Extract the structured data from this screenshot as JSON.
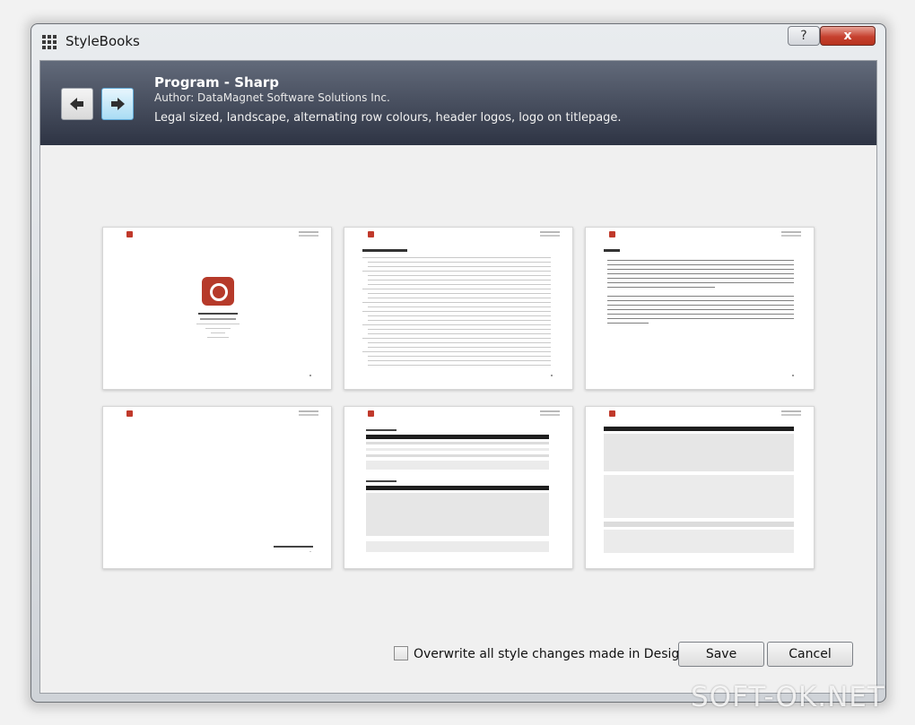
{
  "window": {
    "title": "StyleBooks",
    "help_label": "?",
    "close_label": "x"
  },
  "header": {
    "title": "Program - Sharp",
    "author": "Author: DataMagnet Software Solutions Inc.",
    "description": "Legal sized, landscape, alternating row colours, header logos, logo on titlepage.",
    "prev_icon": "arrow-left-icon",
    "next_icon": "arrow-right-icon"
  },
  "pages": [
    {
      "kind": "title-page"
    },
    {
      "kind": "table-of-contents"
    },
    {
      "kind": "preface-text"
    },
    {
      "kind": "section-end"
    },
    {
      "kind": "data-tables"
    },
    {
      "kind": "data-table-continued"
    }
  ],
  "footer": {
    "overwrite_label": "Overwrite all style changes made in Designer",
    "overwrite_checked": false,
    "save_label": "Save",
    "cancel_label": "Cancel"
  },
  "watermark": "SOFT-OK.NET",
  "colors": {
    "header_top": "#626a7a",
    "header_bottom": "#2e3444",
    "close_button": "#c6412f",
    "logo_red": "#b63a2a"
  }
}
